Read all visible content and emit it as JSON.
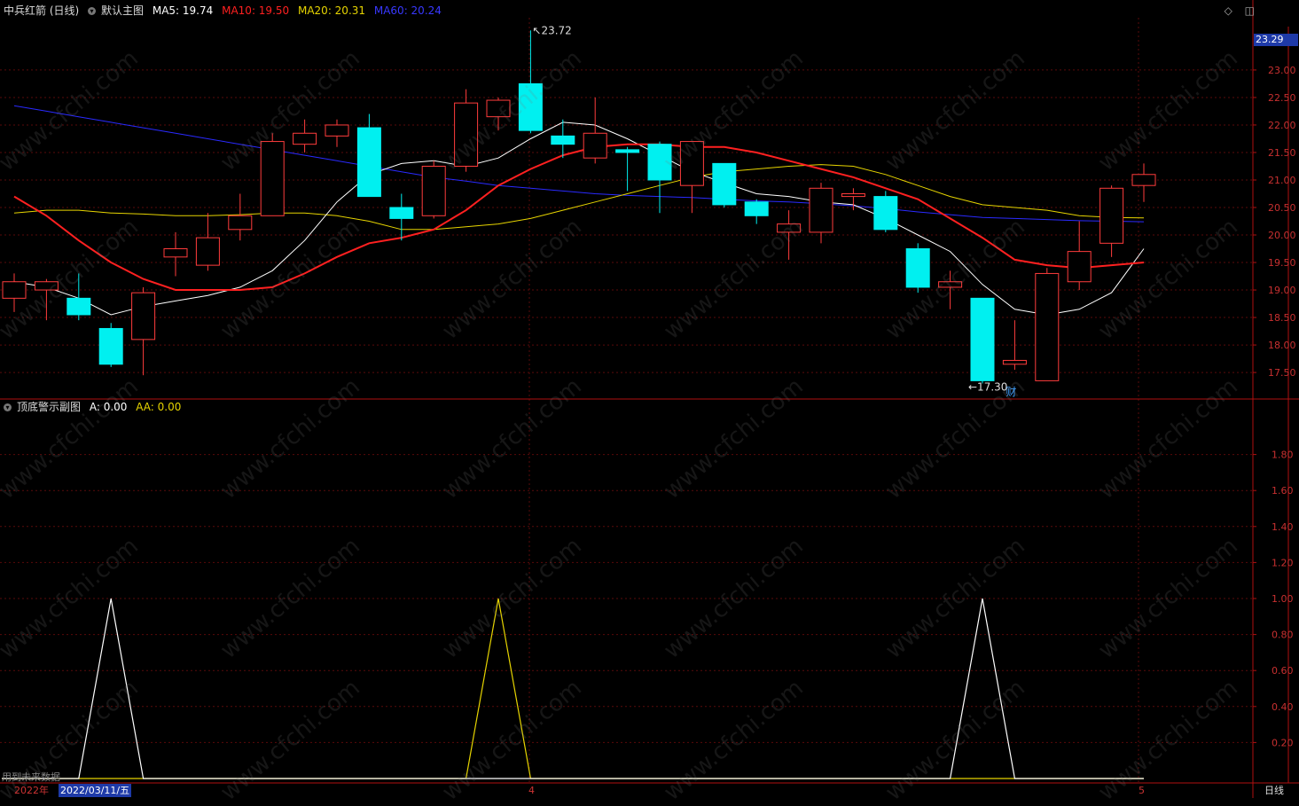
{
  "header": {
    "stock_name": "中兵红箭 (日线)",
    "main_chart_label": "默认主图",
    "ma5": {
      "label": "MA5: 19.74",
      "color": "#ffffff"
    },
    "ma10": {
      "label": "MA10: 19.50",
      "color": "#ff2020"
    },
    "ma20": {
      "label": "MA20: 20.31",
      "color": "#e6d400"
    },
    "ma60": {
      "label": "MA60: 20.24",
      "color": "#2020ff"
    }
  },
  "sub_header": {
    "indicator_label": "顶底警示副图",
    "a_label": "A: 0.00",
    "aa_label": "AA: 0.00",
    "a_color": "#ffffff",
    "aa_color": "#e6d400"
  },
  "price_tag": "23.29",
  "high_label": "23.72",
  "low_label": "17.30",
  "fin_marker": "财",
  "future_tip": "用到未来数据",
  "bottom_bar": {
    "year": "2022年",
    "date": "2022/03/11/五",
    "month_4": "4",
    "month_5": "5",
    "period": "日线"
  },
  "watermark": "www.cfchi.com",
  "price_axis": [
    "23.00",
    "22.50",
    "22.00",
    "21.50",
    "21.00",
    "20.50",
    "20.00",
    "19.50",
    "19.00",
    "18.50",
    "18.00",
    "17.50"
  ],
  "sub_axis": [
    "1.80",
    "1.60",
    "1.40",
    "1.20",
    "1.00",
    "0.80",
    "0.60",
    "0.40",
    "0.20"
  ],
  "chart_data": {
    "type": "candlestick",
    "candles": [
      {
        "o": 18.85,
        "h": 19.3,
        "l": 18.6,
        "c": 19.15
      },
      {
        "o": 19.0,
        "h": 19.2,
        "l": 18.45,
        "c": 19.15
      },
      {
        "o": 18.85,
        "h": 19.3,
        "l": 18.45,
        "c": 18.55
      },
      {
        "o": 18.3,
        "h": 18.4,
        "l": 17.6,
        "c": 17.65
      },
      {
        "o": 18.1,
        "h": 19.05,
        "l": 17.45,
        "c": 18.95
      },
      {
        "o": 19.6,
        "h": 20.05,
        "l": 19.25,
        "c": 19.75
      },
      {
        "o": 19.45,
        "h": 20.4,
        "l": 19.35,
        "c": 19.95
      },
      {
        "o": 20.1,
        "h": 20.75,
        "l": 19.9,
        "c": 20.35
      },
      {
        "o": 20.35,
        "h": 21.85,
        "l": 20.35,
        "c": 21.7
      },
      {
        "o": 21.65,
        "h": 22.1,
        "l": 21.5,
        "c": 21.85
      },
      {
        "o": 21.8,
        "h": 22.1,
        "l": 21.6,
        "c": 22.0
      },
      {
        "o": 21.95,
        "h": 22.2,
        "l": 20.7,
        "c": 20.7
      },
      {
        "o": 20.5,
        "h": 20.75,
        "l": 19.9,
        "c": 20.3
      },
      {
        "o": 20.35,
        "h": 21.35,
        "l": 20.3,
        "c": 21.25
      },
      {
        "o": 21.25,
        "h": 22.65,
        "l": 21.15,
        "c": 22.4
      },
      {
        "o": 22.15,
        "h": 22.5,
        "l": 21.9,
        "c": 22.45
      },
      {
        "o": 22.75,
        "h": 23.72,
        "l": 21.85,
        "c": 21.9
      },
      {
        "o": 21.8,
        "h": 22.1,
        "l": 21.4,
        "c": 21.65
      },
      {
        "o": 21.4,
        "h": 22.5,
        "l": 21.3,
        "c": 21.85
      },
      {
        "o": 21.55,
        "h": 21.6,
        "l": 20.8,
        "c": 21.5
      },
      {
        "o": 21.65,
        "h": 21.7,
        "l": 20.4,
        "c": 21.0
      },
      {
        "o": 20.9,
        "h": 21.7,
        "l": 20.4,
        "c": 21.7
      },
      {
        "o": 21.3,
        "h": 21.3,
        "l": 20.5,
        "c": 20.55
      },
      {
        "o": 20.6,
        "h": 20.65,
        "l": 20.2,
        "c": 20.35
      },
      {
        "o": 20.05,
        "h": 20.45,
        "l": 19.55,
        "c": 20.2
      },
      {
        "o": 20.05,
        "h": 20.95,
        "l": 19.85,
        "c": 20.85
      },
      {
        "o": 20.7,
        "h": 20.85,
        "l": 20.45,
        "c": 20.75
      },
      {
        "o": 20.7,
        "h": 20.8,
        "l": 20.05,
        "c": 20.1
      },
      {
        "o": 19.75,
        "h": 19.85,
        "l": 18.95,
        "c": 19.05
      },
      {
        "o": 19.05,
        "h": 19.35,
        "l": 18.65,
        "c": 19.15
      },
      {
        "o": 18.85,
        "h": 18.85,
        "l": 17.3,
        "c": 17.35
      },
      {
        "o": 17.65,
        "h": 18.45,
        "l": 17.55,
        "c": 17.72
      },
      {
        "o": 17.35,
        "h": 19.4,
        "l": 17.35,
        "c": 19.3
      },
      {
        "o": 19.15,
        "h": 20.25,
        "l": 19.0,
        "c": 19.7
      },
      {
        "o": 19.85,
        "h": 20.9,
        "l": 19.6,
        "c": 20.85
      },
      {
        "o": 20.9,
        "h": 21.3,
        "l": 20.6,
        "c": 21.1
      }
    ],
    "ma5": [
      19.15,
      19.05,
      18.85,
      18.55,
      18.7,
      18.8,
      18.9,
      19.05,
      19.35,
      19.9,
      20.6,
      21.1,
      21.3,
      21.35,
      21.25,
      21.4,
      21.75,
      22.05,
      22.0,
      21.75,
      21.45,
      21.15,
      20.95,
      20.75,
      20.7,
      20.6,
      20.55,
      20.3,
      20.0,
      19.7,
      19.1,
      18.65,
      18.55,
      18.65,
      18.95,
      19.75
    ],
    "ma10": [
      20.7,
      20.35,
      19.9,
      19.5,
      19.2,
      19.0,
      19.0,
      19.0,
      19.05,
      19.3,
      19.6,
      19.85,
      19.95,
      20.1,
      20.45,
      20.9,
      21.2,
      21.45,
      21.6,
      21.65,
      21.65,
      21.6,
      21.6,
      21.5,
      21.35,
      21.2,
      21.05,
      20.85,
      20.65,
      20.3,
      19.95,
      19.55,
      19.45,
      19.4,
      19.45,
      19.5
    ],
    "ma20": [
      20.4,
      20.45,
      20.45,
      20.4,
      20.38,
      20.35,
      20.35,
      20.37,
      20.4,
      20.4,
      20.35,
      20.25,
      20.1,
      20.1,
      20.15,
      20.2,
      20.3,
      20.45,
      20.6,
      20.75,
      20.9,
      21.05,
      21.15,
      21.2,
      21.25,
      21.28,
      21.25,
      21.1,
      20.9,
      20.7,
      20.55,
      20.5,
      20.45,
      20.35,
      20.32,
      20.31
    ],
    "ma60": [
      22.35,
      22.25,
      22.15,
      22.05,
      21.95,
      21.85,
      21.75,
      21.65,
      21.55,
      21.45,
      21.35,
      21.25,
      21.15,
      21.05,
      20.98,
      20.9,
      20.85,
      20.8,
      20.75,
      20.72,
      20.7,
      20.68,
      20.65,
      20.62,
      20.6,
      20.57,
      20.53,
      20.48,
      20.42,
      20.37,
      20.32,
      20.3,
      20.28,
      20.26,
      20.25,
      20.24
    ],
    "price_range": [
      17.05,
      23.95
    ],
    "sub_range": [
      0,
      2
    ],
    "signal_aa": [
      0,
      0,
      0,
      0,
      0,
      0,
      0,
      0,
      0,
      0,
      0,
      0,
      0,
      0,
      0,
      1,
      0,
      0,
      0,
      0,
      0,
      0,
      0,
      0,
      0,
      0,
      0,
      0,
      0,
      0,
      0,
      0,
      0,
      0,
      0,
      0
    ],
    "signal_a": [
      0,
      0,
      0,
      1,
      0,
      0,
      0,
      0,
      0,
      0,
      0,
      0,
      0,
      0,
      0,
      0,
      0,
      0,
      0,
      0,
      0,
      0,
      0,
      0,
      0,
      0,
      0,
      0,
      0,
      0,
      1,
      0,
      0,
      0,
      0,
      0
    ]
  }
}
